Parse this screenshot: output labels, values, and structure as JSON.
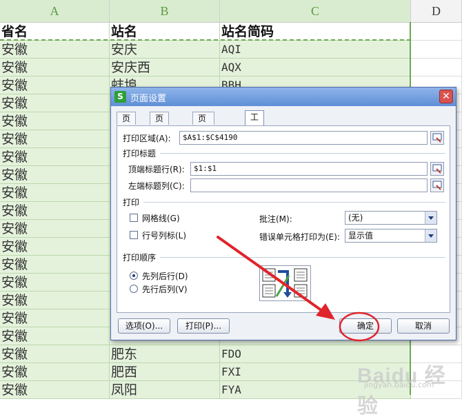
{
  "sheet": {
    "columns": [
      "A",
      "B",
      "C",
      "D"
    ],
    "header_row": [
      "省名",
      "站名",
      "站名简码"
    ],
    "rows": [
      [
        "安徽",
        "安庆",
        "AQI"
      ],
      [
        "安徽",
        "安庆西",
        "AQX"
      ],
      [
        "安徽",
        "蚌埠",
        "BBH"
      ],
      [
        "安徽",
        "",
        ""
      ],
      [
        "安徽",
        "",
        ""
      ],
      [
        "安徽",
        "",
        ""
      ],
      [
        "安徽",
        "",
        ""
      ],
      [
        "安徽",
        "",
        ""
      ],
      [
        "安徽",
        "",
        ""
      ],
      [
        "安徽",
        "",
        ""
      ],
      [
        "安徽",
        "",
        ""
      ],
      [
        "安徽",
        "",
        ""
      ],
      [
        "安徽",
        "",
        ""
      ],
      [
        "安徽",
        "",
        ""
      ],
      [
        "安徽",
        "",
        ""
      ],
      [
        "安徽",
        "",
        ""
      ],
      [
        "安徽",
        "",
        ""
      ],
      [
        "安徽",
        "肥东",
        "FDO"
      ],
      [
        "安徽",
        "肥西",
        "FXI"
      ],
      [
        "安徽",
        "凤阳",
        "FYA"
      ]
    ]
  },
  "dialog": {
    "icon_letter": "S",
    "title": "页面设置",
    "close": "✕",
    "tabs": [
      "页面",
      "页边距",
      "页眉/页脚",
      "工作表"
    ],
    "print_area_label": "打印区域(A):",
    "print_area_value": "$A$1:$C$4190",
    "print_titles_group": "打印标题",
    "top_rows_label": "顶端标题行(R):",
    "top_rows_value": "$1:$1",
    "left_cols_label": "左端标题列(C):",
    "left_cols_value": "",
    "print_group": "打印",
    "gridlines_label": "网格线(G)",
    "row_col_headings_label": "行号列标(L)",
    "comments_label": "批注(M):",
    "comments_value": "(无)",
    "errors_label": "错误单元格打印为(E):",
    "errors_value": "显示值",
    "page_order_group": "打印顺序",
    "down_then_over_label": "先列后行(D)",
    "over_then_down_label": "先行后列(V)",
    "options_button": "选项(O)...",
    "print_button": "打印(P)...",
    "ok_button": "确定",
    "cancel_button": "取消"
  },
  "watermark": {
    "text": "Baidu 经验",
    "sub": "jingyan.baidu.com"
  },
  "colors": {
    "selection_fill": "#e4f2dc",
    "selection_border": "#6aa84f",
    "annotation_red": "#e0242c",
    "dialog_title": "#5f8fd6"
  }
}
